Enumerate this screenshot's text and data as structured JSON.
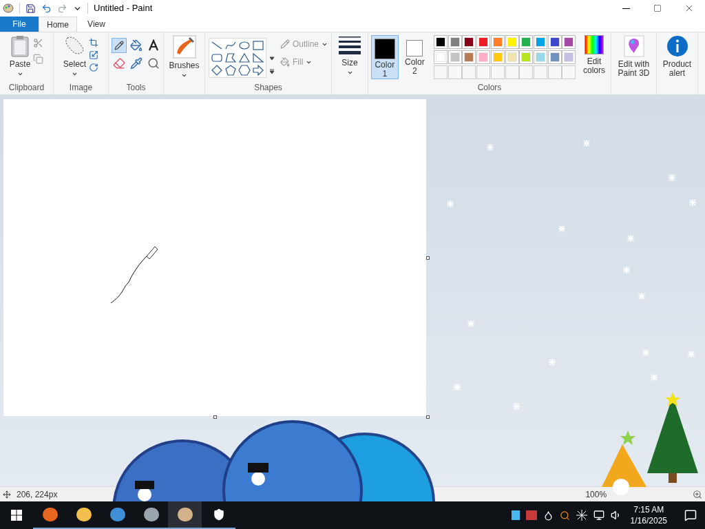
{
  "window": {
    "title": "Untitled - Paint"
  },
  "tabs": [
    {
      "label": "File",
      "kind": "file",
      "selected": false
    },
    {
      "label": "Home",
      "kind": "tab",
      "selected": true
    },
    {
      "label": "View",
      "kind": "tab",
      "selected": false
    }
  ],
  "ribbon": {
    "clipboard": {
      "paste": "Paste",
      "group": "Clipboard"
    },
    "image": {
      "select": "Select",
      "group": "Image"
    },
    "tools": {
      "group": "Tools",
      "pencil_selected": true
    },
    "brushes": {
      "label": "Brushes"
    },
    "shapes": {
      "outline": "Outline",
      "fill": "Fill",
      "group": "Shapes"
    },
    "size": {
      "label": "Size"
    },
    "colors": {
      "group": "Colors",
      "current": [
        {
          "label": "Color",
          "number": "1",
          "color": "#000000",
          "selected": true
        },
        {
          "label": "Color",
          "number": "2",
          "color": "#ffffff",
          "selected": false
        }
      ],
      "palette": [
        {
          "color": "#000000"
        },
        {
          "color": "#7f7f7f"
        },
        {
          "color": "#880015"
        },
        {
          "color": "#ed1c24"
        },
        {
          "color": "#ff7f27"
        },
        {
          "color": "#fff200"
        },
        {
          "color": "#22b14c"
        },
        {
          "color": "#00a2e8"
        },
        {
          "color": "#3f48cc"
        },
        {
          "color": "#a349a4"
        },
        {
          "color": "#ffffff"
        },
        {
          "color": "#c3c3c3"
        },
        {
          "color": "#b97a57"
        },
        {
          "color": "#ffaec9"
        },
        {
          "color": "#ffc90e"
        },
        {
          "color": "#efe4b0"
        },
        {
          "color": "#b5e61d"
        },
        {
          "color": "#99d9ea"
        },
        {
          "color": "#7092be"
        },
        {
          "color": "#c8bfe7"
        }
      ],
      "edit": "Edit colors"
    },
    "paint3d": "Edit with Paint 3D",
    "product_alert": "Product alert"
  },
  "status_bar": {
    "position": "206, 224px",
    "zoom": "100%"
  },
  "taskbar": {
    "time": "7:15 AM",
    "date": "1/16/2025"
  }
}
